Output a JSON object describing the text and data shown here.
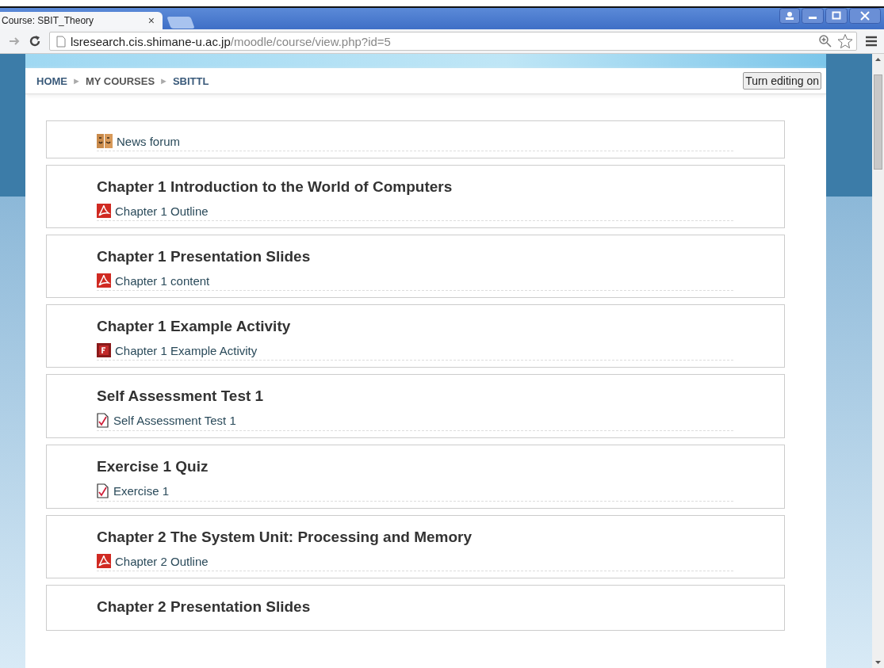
{
  "browser": {
    "tab": {
      "title": "Course: SBIT_Theory",
      "close": "×"
    },
    "address": {
      "host": "lsresearch.cis.shimane-u.ac.jp",
      "path": "/moodle/course/view.php?id=5"
    }
  },
  "breadcrumb": {
    "separator": "►",
    "items": [
      {
        "label": "HOME",
        "link": true
      },
      {
        "label": "MY COURSES",
        "link": false
      },
      {
        "label": "SBITTL",
        "link": true
      }
    ]
  },
  "edit_button": "Turn editing on",
  "sections": [
    {
      "activity": {
        "kind": "forum",
        "label": "News forum"
      }
    },
    {
      "title": "Chapter 1 Introduction to the World of Computers",
      "activity": {
        "kind": "pdf",
        "label": "Chapter 1 Outline"
      }
    },
    {
      "title": "Chapter 1 Presentation Slides",
      "activity": {
        "kind": "pdf",
        "label": "Chapter 1 content"
      }
    },
    {
      "title": "Chapter 1 Example Activity",
      "activity": {
        "kind": "flash",
        "label": "Chapter 1 Example Activity"
      }
    },
    {
      "title": "Self Assessment Test 1",
      "activity": {
        "kind": "quiz",
        "label": "Self Assessment Test 1"
      }
    },
    {
      "title": "Exercise 1 Quiz",
      "activity": {
        "kind": "quiz",
        "label": "Exercise 1"
      }
    },
    {
      "title": "Chapter 2 The System Unit: Processing and Memory",
      "activity": {
        "kind": "pdf",
        "label": "Chapter 2 Outline"
      }
    },
    {
      "title": "Chapter 2 Presentation Slides"
    }
  ]
}
